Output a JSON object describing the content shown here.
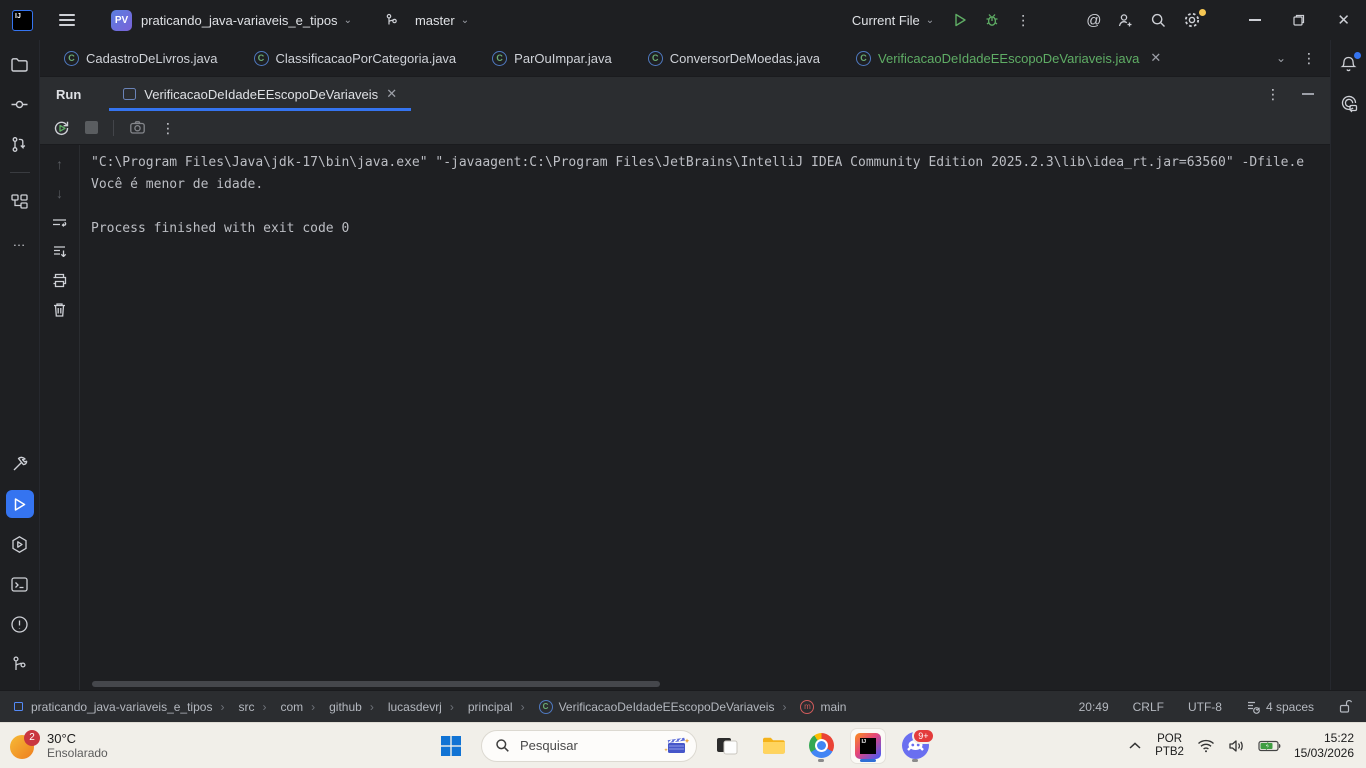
{
  "colors": {
    "accent_blue": "#3574f0",
    "run_green": "#5fad65",
    "added_file_green": "#5fad65",
    "gear_badge_yellow": "#f5c653",
    "notification_dot_blue": "#3574f0",
    "badge_red": "#c9363f",
    "ide_background": "#1e1f22",
    "panel_background": "#2b2d30",
    "taskbar_background": "#f1efe9"
  },
  "title_bar": {
    "project_badge": "PV",
    "project_name": "praticando_java-variaveis_e_tipos",
    "branch_name": "master",
    "run_config": "Current File"
  },
  "editor_tabs": [
    {
      "label": "CadastroDeLivros.java"
    },
    {
      "label": "ClassificacaoPorCategoria.java"
    },
    {
      "label": "ParOuImpar.java"
    },
    {
      "label": "ConversorDeMoedas.java"
    },
    {
      "label": "VerificacaoDeIdadeEEscopoDeVariaveis.java",
      "active": true
    }
  ],
  "run_panel": {
    "title": "Run",
    "tab_label": "VerificacaoDeIdadeEEscopoDeVariaveis",
    "console": {
      "line1": "\"C:\\Program Files\\Java\\jdk-17\\bin\\java.exe\" \"-javaagent:C:\\Program Files\\JetBrains\\IntelliJ IDEA Community Edition 2025.2.3\\lib\\idea_rt.jar=63560\" -Dfile.e",
      "line2": "Você é menor de idade.",
      "line3": "",
      "line4": "Process finished with exit code 0"
    }
  },
  "status_bar": {
    "breadcrumbs": [
      "praticando_java-variaveis_e_tipos",
      "src",
      "com",
      "github",
      "lucasdevrj",
      "principal",
      "VerificacaoDeIdadeEEscopoDeVariaveis",
      "main"
    ],
    "cursor_position": "20:49",
    "line_separator": "CRLF",
    "encoding": "UTF-8",
    "indent": "4 spaces"
  },
  "taskbar": {
    "weather": {
      "badge": "2",
      "temperature": "30°C",
      "condition": "Ensolarado"
    },
    "search": {
      "placeholder": "Pesquisar"
    },
    "discord_badge": "9+",
    "tray": {
      "language_top": "POR",
      "language_bottom": "PTB2",
      "time": "15:22",
      "date": "15/03/2026"
    }
  },
  "icons": {
    "class_glyph": "C",
    "method_glyph": "m",
    "hamburger-menu-icon": "three bars",
    "branch-icon": "git branch",
    "play-icon": "green triangle",
    "debug-icon": "green bug",
    "ai-assistant-icon": "@ swirl",
    "add-user-icon": "person plus",
    "search-icon": "magnifier",
    "gear-icon": "gear with yellow dot",
    "bell-icon": "bell with blue dot",
    "rerun-icon": "circular arrow with play",
    "stop-icon": "gray square",
    "trash-icon": "bin",
    "printer-icon": "printer",
    "windows-start-icon": "four blue squares",
    "chrome-icon": "colored ring",
    "discord-icon": "violet mascot",
    "wifi-icon": "arcs",
    "volume-icon": "speaker",
    "battery-icon": "green charging battery"
  }
}
